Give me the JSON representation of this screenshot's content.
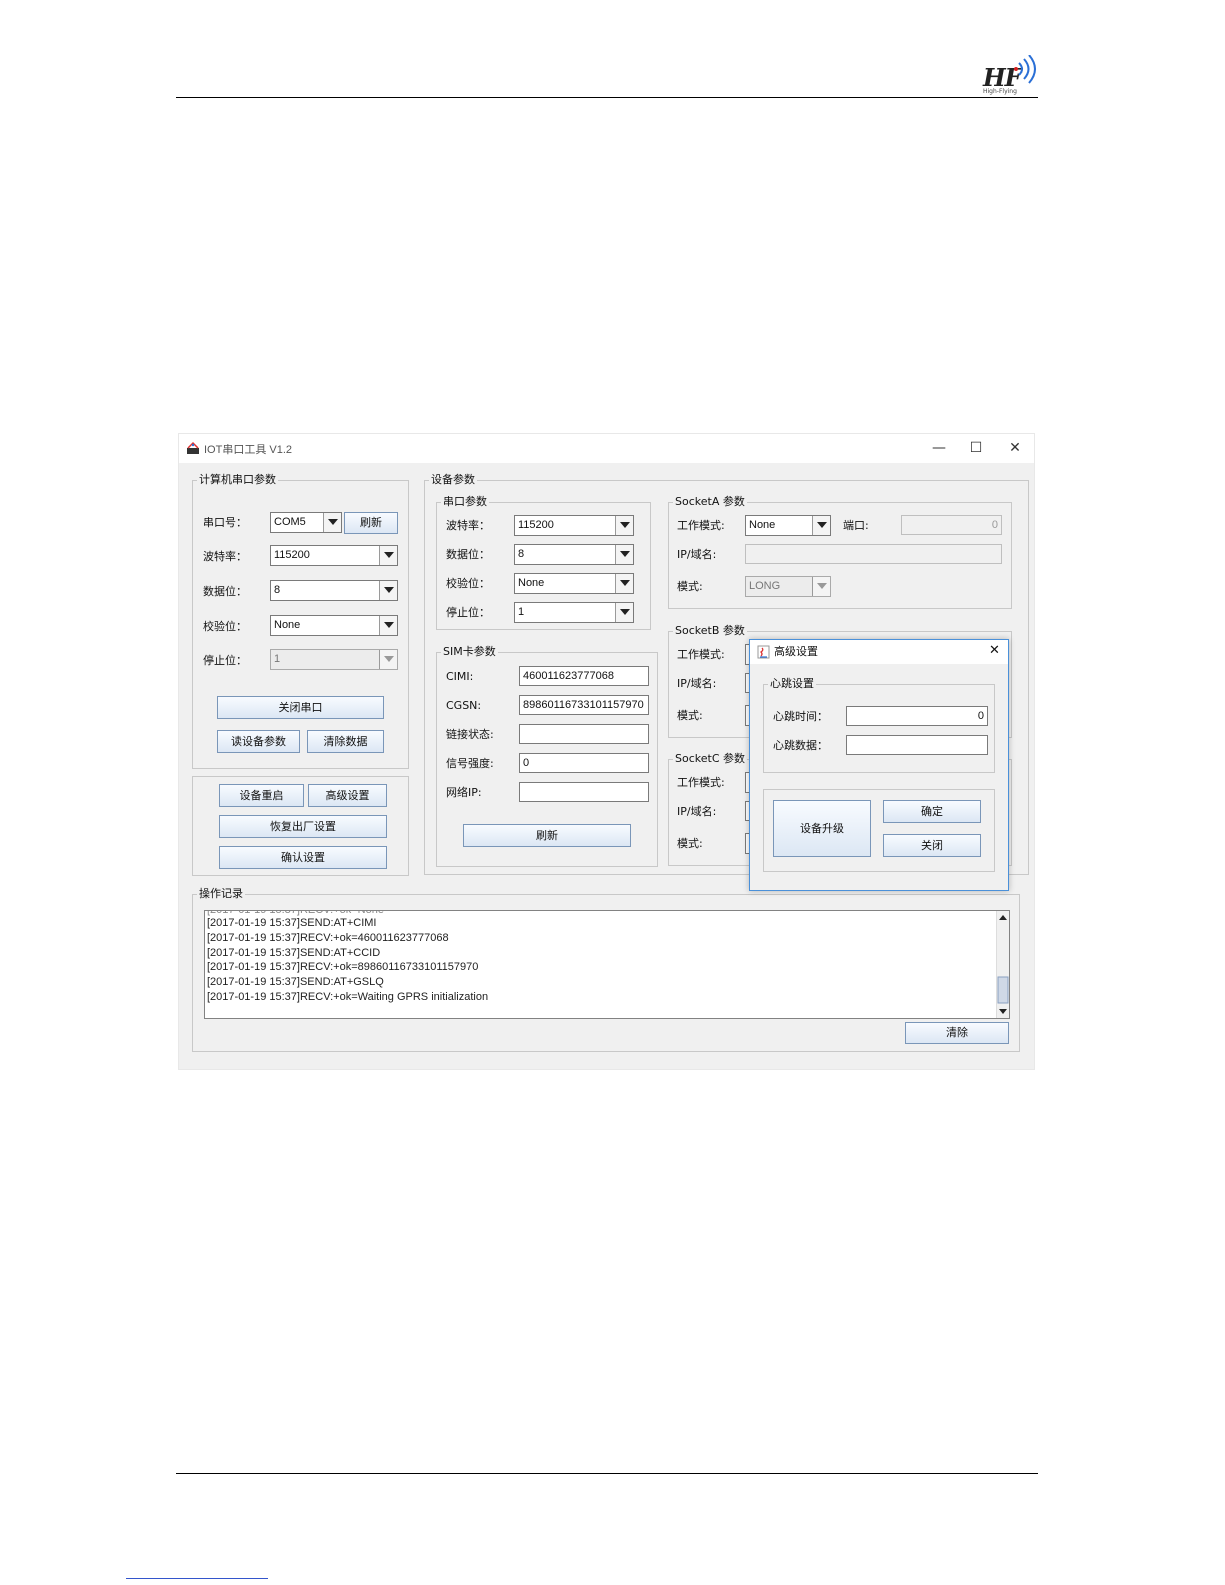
{
  "logo": {
    "brand": "HF",
    "tagline": "High-Flying"
  },
  "window": {
    "title": "IOT串口工具 V1.2",
    "minimize": "—",
    "maximize": "☐",
    "close": "✕"
  },
  "pc_serial": {
    "title": "计算机串口参数",
    "port_label": "串口号：",
    "port_value": "COM5",
    "refresh": "刷新",
    "baud_label": "波特率：",
    "baud_value": "115200",
    "databits_label": "数据位：",
    "databits_value": "8",
    "parity_label": "校验位：",
    "parity_value": "None",
    "stopbits_label": "停止位：",
    "stopbits_value": "1",
    "close_port": "关闭串口",
    "read_params": "读设备参数",
    "clear_data": "清除数据"
  },
  "actions": {
    "restart": "设备重启",
    "advanced": "高级设置",
    "factory_reset": "恢复出厂设置",
    "confirm": "确认设置"
  },
  "device": {
    "title": "设备参数",
    "serial": {
      "title": "串口参数",
      "baud_label": "波特率：",
      "baud_value": "115200",
      "databits_label": "数据位：",
      "databits_value": "8",
      "parity_label": "校验位：",
      "parity_value": "None",
      "stopbits_label": "停止位：",
      "stopbits_value": "1"
    },
    "sim": {
      "title": "SIM卡参数",
      "cimi_label": "CIMI:",
      "cimi_value": "460011623777068",
      "cgsn_label": "CGSN:",
      "cgsn_value": "89860116733101157970",
      "link_label": "链接状态:",
      "link_value": "",
      "signal_label": "信号强度:",
      "signal_value": "0",
      "ip_label": "网络IP:",
      "ip_value": "",
      "refresh": "刷新"
    },
    "socketA": {
      "title": "SocketA 参数",
      "mode_label": "工作模式:",
      "mode_value": "None",
      "port_label": "端口:",
      "port_value": "0",
      "ip_label": "IP/域名:",
      "ip_value": "",
      "type_label": "模式:",
      "type_value": "LONG"
    },
    "socketB": {
      "title": "SocketB 参数",
      "mode_label": "工作模式:",
      "ip_label": "IP/域名:",
      "type_label": "模式:"
    },
    "socketC": {
      "title": "SocketC 参数",
      "mode_label": "工作模式:",
      "ip_label": "IP/域名:",
      "type_label": "模式:"
    }
  },
  "log": {
    "title": "操作记录",
    "lines": [
      "[2017-01-19 15:37]SEND:AT+CIMI",
      "[2017-01-19 15:37]RECV:+ok=460011623777068",
      "[2017-01-19 15:37]SEND:AT+CCID",
      "[2017-01-19 15:37]RECV:+ok=89860116733101157970",
      "[2017-01-19 15:37]SEND:AT+GSLQ",
      "[2017-01-19 15:37]RECV:+ok=Waiting GPRS initialization"
    ],
    "clear": "清除"
  },
  "dialog": {
    "title": "高级设置",
    "close": "✕",
    "heartbeat_group": "心跳设置",
    "hb_time_label": "心跳时间：",
    "hb_time_value": "0",
    "hb_data_label": "心跳数据：",
    "hb_data_value": "",
    "upgrade": "设备升级",
    "ok": "确定",
    "cancel": "关闭"
  },
  "colors": {
    "accent": "#4a90d9",
    "button_border": "#7a96b8",
    "panel_bg": "#f0f0f0"
  }
}
